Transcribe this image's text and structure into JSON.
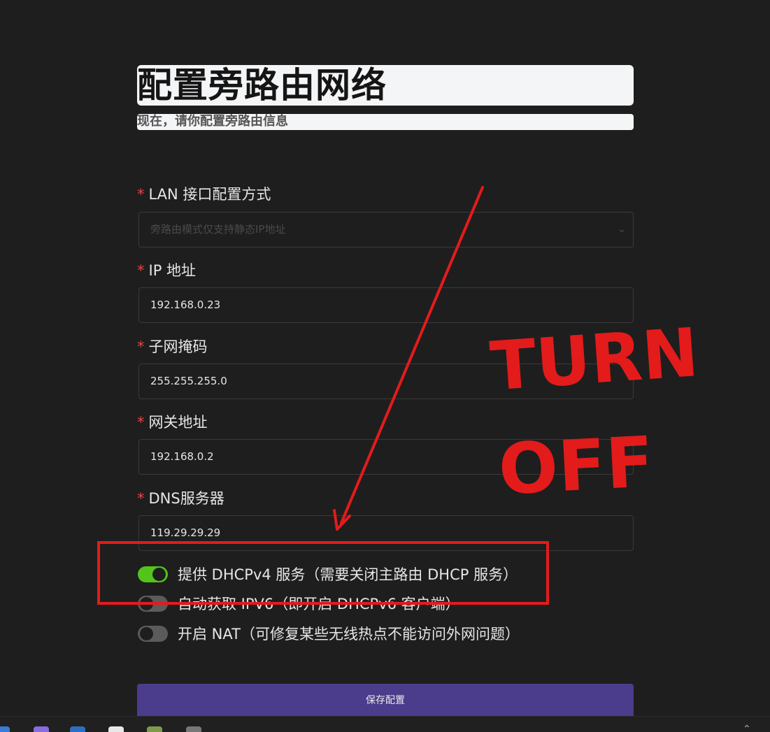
{
  "header": {
    "title": "配置旁路由网络",
    "subtitle": "现在，请你配置旁路由信息"
  },
  "form": {
    "required_mark": "*",
    "lan_mode": {
      "label": "LAN 接口配置方式",
      "placeholder": "旁路由模式仅支持静态IP地址",
      "chevron": "⌄"
    },
    "ip": {
      "label": "IP 地址",
      "value": "192.168.0.23"
    },
    "netmask": {
      "label": "子网掩码",
      "value": "255.255.255.0"
    },
    "gateway": {
      "label": "网关地址",
      "value": "192.168.0.2"
    },
    "dns": {
      "label": "DNS服务器",
      "value": "119.29.29.29"
    }
  },
  "toggles": [
    {
      "label": "提供 DHCPv4 服务（需要关闭主路由 DHCP 服务）",
      "on": true
    },
    {
      "label": "自动获取 IPV6（即开启 DHCPv6 客户端）",
      "on": false
    },
    {
      "label": "开启 NAT（可修复某些无线热点不能访问外网问题）",
      "on": false
    }
  ],
  "save_button": {
    "label": "保存配置"
  },
  "annotation": {
    "line1": "TURN",
    "line2": "OFF",
    "color": "#e31b1b"
  },
  "taskbar": {
    "icons": [
      "app-icon-1",
      "app-icon-2",
      "app-icon-3",
      "app-icon-4",
      "app-icon-5",
      "app-icon-6"
    ],
    "chevron": "⌃"
  }
}
